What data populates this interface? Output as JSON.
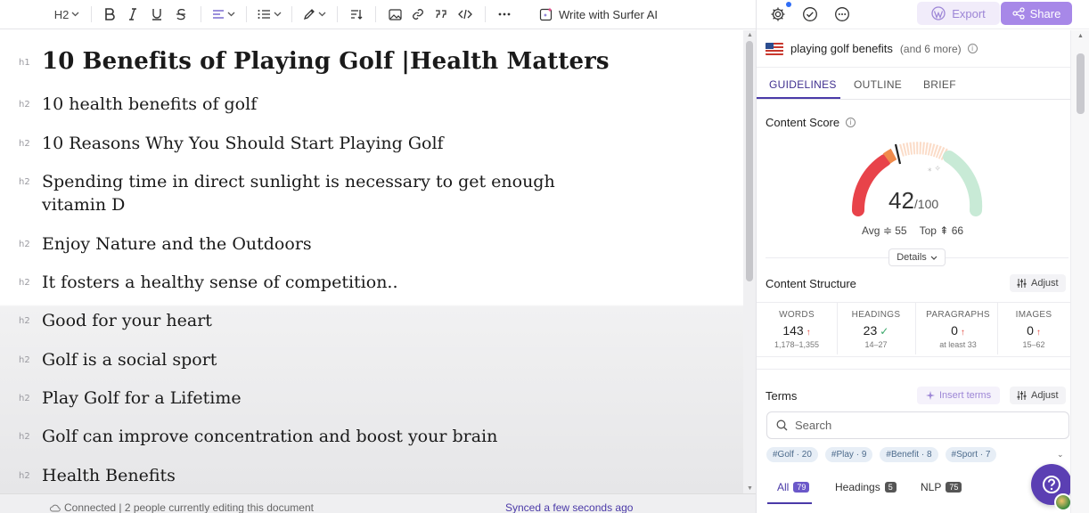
{
  "toolbar": {
    "heading_level": "H2",
    "write_ai_label": "Write with Surfer AI"
  },
  "document": {
    "headings": [
      {
        "tag": "h1",
        "text": "10 Benefits of Playing Golf |Health Matters"
      },
      {
        "tag": "h2",
        "text": "10 health benefits of golf"
      },
      {
        "tag": "h2",
        "text": "10 Reasons Why You Should Start Playing Golf"
      },
      {
        "tag": "h2",
        "text": "Spending time in direct sunlight is necessary to get enough",
        "text2": "vitamin D"
      },
      {
        "tag": "h2",
        "text": "Enjoy Nature and the Outdoors"
      },
      {
        "tag": "h2",
        "text": "It fosters a healthy sense of competition.."
      },
      {
        "tag": "h2",
        "text": "Good for your heart"
      },
      {
        "tag": "h2",
        "text": "Golf is a social sport"
      },
      {
        "tag": "h2",
        "text": "Play Golf for a Lifetime"
      },
      {
        "tag": "h2",
        "text": "Golf can improve concentration and boost your brain"
      },
      {
        "tag": "h2",
        "text": "Health Benefits"
      }
    ]
  },
  "status": {
    "connected": "Connected | 2 people currently editing this document",
    "synced": "Synced a few seconds ago"
  },
  "panel": {
    "export_label": "Export",
    "share_label": "Share",
    "keyword": "playing golf benefits",
    "keyword_more": "(and 6 more)",
    "tabs": [
      "GUIDELINES",
      "OUTLINE",
      "BRIEF"
    ],
    "content_score": {
      "title": "Content Score",
      "score": "42",
      "max": "/100",
      "avg_label": "Avg",
      "avg_value": "55",
      "top_label": "Top",
      "top_value": "66",
      "details_label": "Details"
    },
    "structure": {
      "title": "Content Structure",
      "adjust_label": "Adjust",
      "stats": [
        {
          "label": "WORDS",
          "value": "143",
          "status": "up",
          "range": "1,178–1,355"
        },
        {
          "label": "HEADINGS",
          "value": "23",
          "status": "ok",
          "range": "14–27"
        },
        {
          "label": "PARAGRAPHS",
          "value": "0",
          "status": "up",
          "range": "at least 33"
        },
        {
          "label": "IMAGES",
          "value": "0",
          "status": "up",
          "range": "15–62"
        }
      ]
    },
    "terms": {
      "title": "Terms",
      "insert_label": "Insert terms",
      "adjust_label": "Adjust",
      "search_placeholder": "Search",
      "chips": [
        "#Golf · 20",
        "#Play · 9",
        "#Benefit · 8",
        "#Sport · 7"
      ],
      "filter_tabs": [
        {
          "label": "All",
          "count": "79"
        },
        {
          "label": "Headings",
          "count": "5"
        },
        {
          "label": "NLP",
          "count": "75"
        }
      ]
    },
    "colors": {
      "accent": "#4a3aa8",
      "share": "#a788e8",
      "gauge_red": "#e8434a",
      "gauge_green": "#c8ead6",
      "gauge_peach": "#fbdcc8"
    }
  }
}
